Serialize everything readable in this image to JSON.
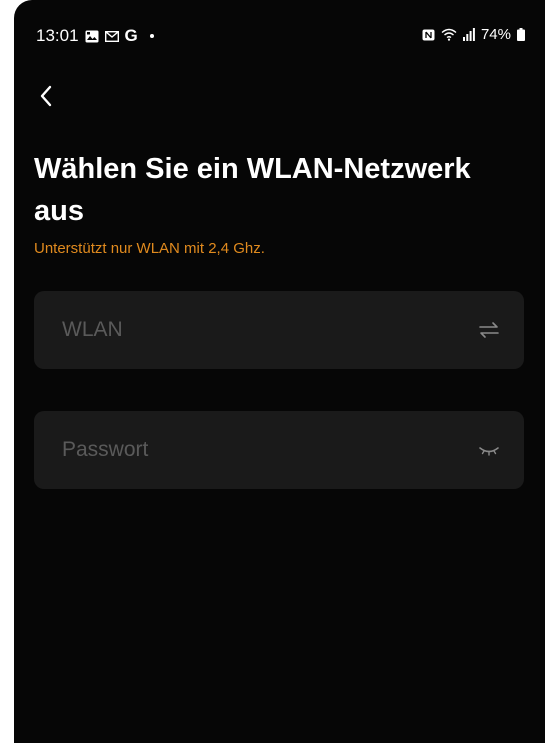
{
  "status_bar": {
    "time": "13:01",
    "left_icons": [
      "gallery-icon",
      "gmail-icon",
      "google-icon",
      "dot-icon"
    ],
    "google_letter": "G",
    "battery_percent": "74%",
    "right_icons": [
      "nfc-icon",
      "wifi-icon",
      "signal-icon",
      "battery-icon"
    ]
  },
  "header": {
    "back_icon": "chevron-left-icon"
  },
  "title": "Wählen Sie ein WLAN-Netzwerk aus",
  "subtitle": "Unterstützt nur WLAN mit 2,4 Ghz.",
  "form": {
    "wifi": {
      "value": "",
      "placeholder": "WLAN",
      "action_icon": "switch-arrows-icon"
    },
    "password": {
      "value": "",
      "placeholder": "Passwort",
      "action_icon": "eye-closed-icon"
    }
  },
  "colors": {
    "background": "#060606",
    "field_background": "#1a1a1a",
    "accent": "#e08a1e",
    "text": "#ffffff",
    "placeholder": "#5a5a5a"
  }
}
